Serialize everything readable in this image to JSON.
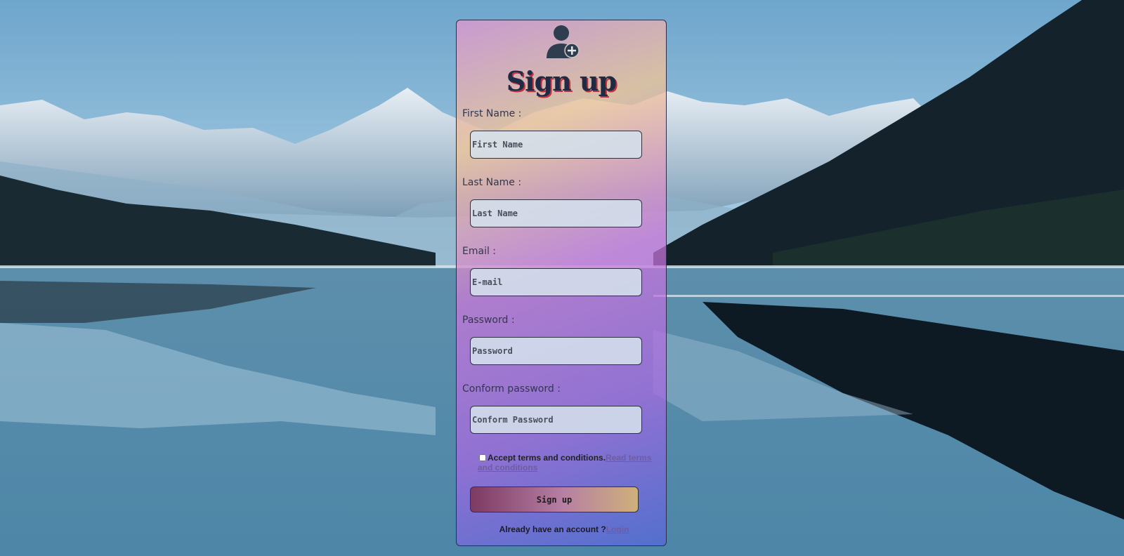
{
  "page": {
    "title": "Sign up"
  },
  "form": {
    "fields": [
      {
        "label": "First Name :",
        "placeholder": "First Name"
      },
      {
        "label": "Last Name :",
        "placeholder": "Last Name"
      },
      {
        "label": "Email :",
        "placeholder": "E-mail"
      },
      {
        "label": "Password :",
        "placeholder": "Password"
      },
      {
        "label": "Conform password :",
        "placeholder": "Conform Password"
      }
    ],
    "terms": {
      "text": "Accept terms and conditions.",
      "link": "Read terms and conditions",
      "checked": false
    },
    "submit_label": "Sign up",
    "login_prompt": "Already have an account ?",
    "login_link": "Login"
  },
  "icons": {
    "header": "user-plus-icon"
  },
  "colors": {
    "title_text": "#1f2a45",
    "title_shadow": "#c0333e",
    "link": "#6e5ca3",
    "button_gradient_start": "#7d3a63",
    "button_gradient_end": "#cfb07a"
  }
}
